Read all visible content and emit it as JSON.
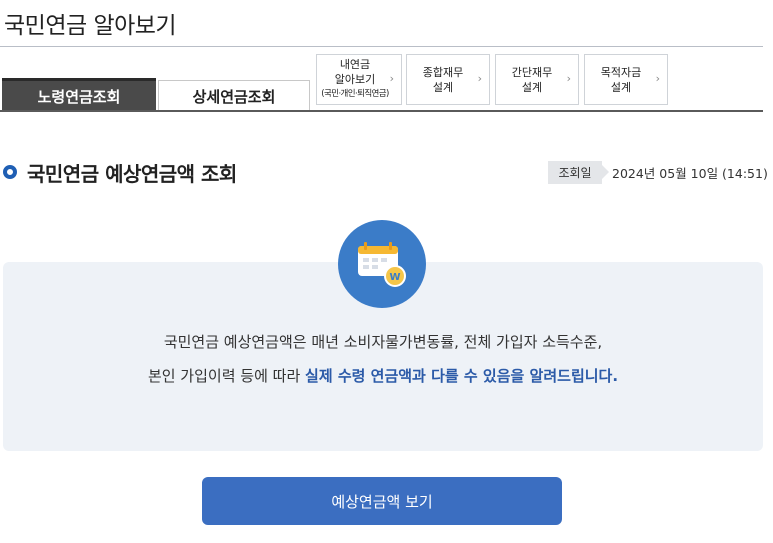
{
  "header": {
    "title": "국민연금 알아보기"
  },
  "tabs": [
    {
      "label": "노령연금조회",
      "active": true
    },
    {
      "label": "상세연금조회",
      "active": false
    }
  ],
  "quick_links": [
    {
      "line1": "내연금",
      "line2": "알아보기",
      "line3": "(국민·개인·퇴직연금)"
    },
    {
      "line1": "종합재무",
      "line2": "설계"
    },
    {
      "line1": "간단재무",
      "line2": "설계"
    },
    {
      "line1": "목적자금",
      "line2": "설계"
    }
  ],
  "quick_link_chevron": "›",
  "section": {
    "title": "국민연금 예상연금액 조회"
  },
  "lookup": {
    "label": "조회일",
    "value": "2024년 05월 10일 (14:51)"
  },
  "info": {
    "line1": "국민연금 예상연금액은 매년 소비자물가변동률, 전체 가입자 소득수준,",
    "line2_prefix": "본인 가입이력 등에 따라 ",
    "line2_highlight": "실제 수령 연금액과 다를 수 있음을 알려드립니다.",
    "icon": "calendar-money-icon",
    "icon_badge": "W"
  },
  "actions": {
    "view_button": "예상연금액 보기"
  },
  "colors": {
    "accent": "#3b6ec1",
    "bullet": "#1f5fb4",
    "highlight": "#2b5aa8",
    "tab_active": "#4a4a4a"
  }
}
